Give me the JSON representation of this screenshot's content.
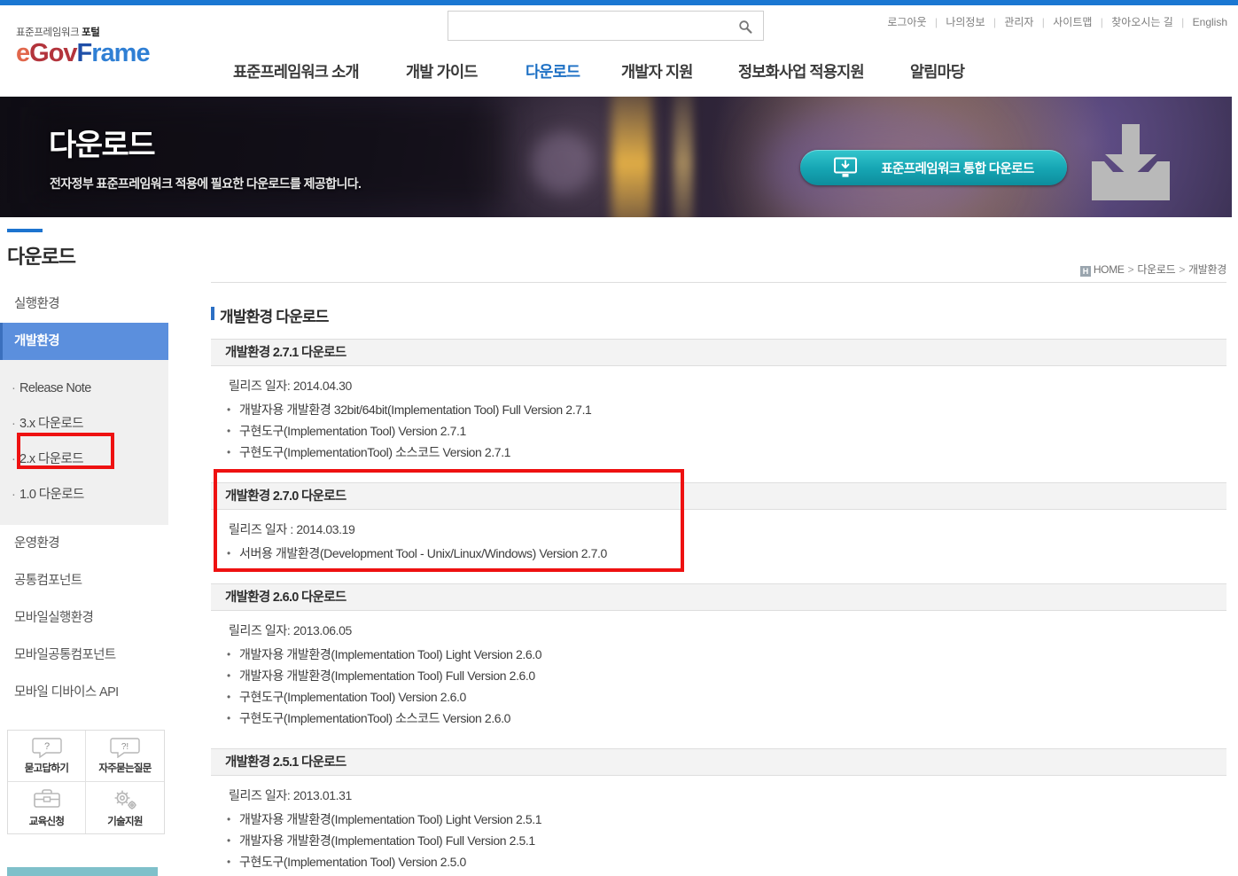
{
  "site": {
    "logo_sub_plain": "표준프레임워크",
    "logo_sub_bold": "포털",
    "logo_e": "e",
    "logo_gov": "Gov",
    "logo_f": "F",
    "logo_rame": "rame",
    "accent_blue": "#1a77d2",
    "active_blue": "#5b8fdd",
    "teal": "#16a6b4",
    "annotation_red": "#ee1111"
  },
  "search": {
    "value": "",
    "placeholder": "",
    "icon": "search-icon"
  },
  "utilnav": {
    "items": [
      "로그아웃",
      "나의정보",
      "관리자",
      "사이트맵",
      "찾아오시는 길",
      "English"
    ],
    "separator": "|"
  },
  "mainnav": {
    "items": [
      {
        "label": "표준프레임워크 소개",
        "active": false
      },
      {
        "label": "개발 가이드",
        "active": false
      },
      {
        "label": "다운로드",
        "active": true
      },
      {
        "label": "개발자 지원",
        "active": false
      },
      {
        "label": "정보화사업 적용지원",
        "active": false
      },
      {
        "label": "알림마당",
        "active": false
      }
    ]
  },
  "hero": {
    "title": "다운로드",
    "description": "전자정부 표준프레임워크 적용에 필요한 다운로드를 제공합니다.",
    "button_label": "표준프레임워크  통합 다운로드",
    "button_icon": "monitor-download-icon",
    "side_icon": "download-tray-icon"
  },
  "sidebar": {
    "title": "다운로드",
    "items": [
      {
        "label": "실행환경",
        "active": false
      },
      {
        "label": "개발환경",
        "active": true
      }
    ],
    "sub_items": [
      {
        "label": "Release Note",
        "highlighted": false
      },
      {
        "label": "3.x 다운로드",
        "highlighted": false
      },
      {
        "label": "2.x 다운로드",
        "highlighted": true
      },
      {
        "label": "1.0 다운로드",
        "highlighted": false
      }
    ],
    "items_after": [
      {
        "label": "운영환경"
      },
      {
        "label": "공통컴포넌트"
      },
      {
        "label": "모바일실행환경"
      },
      {
        "label": "모바일공통컴포넌트"
      },
      {
        "label": "모바일 디바이스 API"
      }
    ],
    "quicklinks": [
      {
        "label": "묻고답하기",
        "icon": "question-bubble-icon"
      },
      {
        "label": "자주묻는질문",
        "icon": "faq-bubble-icon"
      },
      {
        "label": "교육신청",
        "icon": "toolbox-icon"
      },
      {
        "label": "기술지원",
        "icon": "gears-icon"
      }
    ]
  },
  "breadcrumb": {
    "home_icon": "home-icon",
    "home": "HOME",
    "sep": ">",
    "level2": "다운로드",
    "level3": "개발환경"
  },
  "main": {
    "heading": "개발환경 다운로드",
    "sections": [
      {
        "title": "개발환경 2.7.1 다운로드",
        "release_date": "릴리즈 일자: 2014.04.30",
        "items": [
          "개발자용 개발환경 32bit/64bit(Implementation Tool) Full Version 2.7.1",
          "구현도구(Implementation Tool) Version 2.7.1",
          "구현도구(ImplementationTool) 소스코드 Version 2.7.1"
        ],
        "highlighted": false
      },
      {
        "title": "개발환경 2.7.0 다운로드",
        "release_date": "릴리즈 일자 : 2014.03.19",
        "items": [
          "서버용 개발환경(Development Tool - Unix/Linux/Windows) Version 2.7.0"
        ],
        "highlighted": true
      },
      {
        "title": "개발환경 2.6.0 다운로드",
        "release_date": "릴리즈 일자: 2013.06.05",
        "items": [
          "개발자용 개발환경(Implementation Tool) Light Version 2.6.0",
          "개발자용 개발환경(Implementation Tool) Full Version 2.6.0",
          "구현도구(Implementation Tool) Version 2.6.0",
          "구현도구(ImplementationTool) 소스코드 Version 2.6.0"
        ],
        "highlighted": false
      },
      {
        "title": "개발환경 2.5.1 다운로드",
        "release_date": "릴리즈 일자: 2013.01.31",
        "items": [
          "개발자용 개발환경(Implementation Tool) Light Version 2.5.1",
          "개발자용 개발환경(Implementation Tool) Full Version 2.5.1",
          "구현도구(Implementation Tool) Version 2.5.0"
        ],
        "highlighted": false
      }
    ]
  }
}
